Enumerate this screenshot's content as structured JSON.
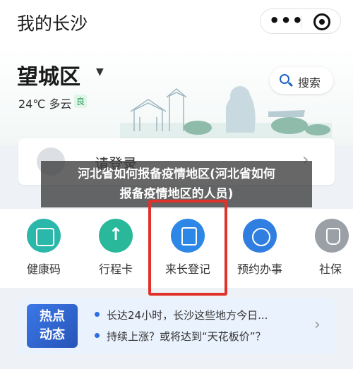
{
  "header": {
    "title": "我的长沙",
    "more_icon": "more-dots-icon",
    "close_icon": "target-icon"
  },
  "hero": {
    "district": "望城区",
    "weather": "24℃ 多云",
    "aqi": "良",
    "search_label": "搜索"
  },
  "login": {
    "text": "请登录"
  },
  "overlay": {
    "line1": "河北省如何报备疫情地区(河北省如何",
    "line2": "报备疫情地区的人员)"
  },
  "services": [
    {
      "label": "健康码",
      "icon": "health-code-icon"
    },
    {
      "label": "行程卡",
      "icon": "trip-card-icon"
    },
    {
      "label": "来长登记",
      "icon": "register-icon"
    },
    {
      "label": "预约办事",
      "icon": "appointment-clock-icon"
    },
    {
      "label": "社保",
      "icon": "social-security-icon"
    }
  ],
  "news": {
    "badge_line1": "热点",
    "badge_line2": "动态",
    "items": [
      "长达24小时，长沙这些地方今日...",
      "持续上涨？或将达到“天花板价”？"
    ]
  },
  "colors": {
    "primary_blue": "#2c6fe0",
    "highlight_red": "#e0312b",
    "teal": "#2bb7a9"
  }
}
